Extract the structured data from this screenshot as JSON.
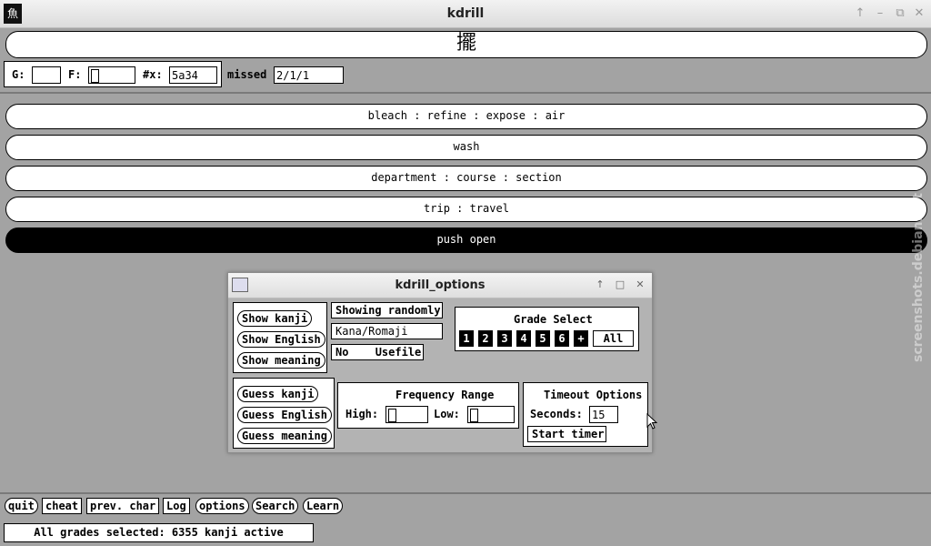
{
  "window": {
    "title": "kdrill",
    "app_icon_glyph": "魚"
  },
  "kanji": {
    "character": "擺"
  },
  "search": {
    "grade_label": "G:",
    "grade_value": "",
    "frequency_label": "F:",
    "frequency_value": "",
    "index_label": "#x:",
    "index_value": "5a34",
    "missed_label": "missed",
    "missed_value": "2/1/1"
  },
  "choices": [
    {
      "label": "bleach : refine : expose : air"
    },
    {
      "label": "wash"
    },
    {
      "label": "department : course : section"
    },
    {
      "label": "trip : travel"
    },
    {
      "label": "push open"
    }
  ],
  "options_dialog": {
    "title": "kdrill_options",
    "show_buttons": [
      "Show kanji",
      "Show English",
      "Show meaning"
    ],
    "showing_order": "Showing randomly",
    "reading_mode": "Kana/Romaji",
    "usefile_state": "No",
    "usefile_label": "Usefile",
    "grade_select_title": "Grade Select",
    "grades": [
      "1",
      "2",
      "3",
      "4",
      "5",
      "6",
      "+"
    ],
    "all_label": "All",
    "guess_buttons": [
      "Guess kanji",
      "Guess English",
      "Guess meaning"
    ],
    "frequency_range_title": "Frequency Range",
    "high_label": "High:",
    "high_value": "",
    "low_label": "Low:",
    "low_value": "",
    "timeout_title": "Timeout Options",
    "seconds_label": "Seconds:",
    "seconds_value": "15",
    "start_timer_label": "Start timer"
  },
  "bottom_buttons": {
    "quit": "quit",
    "cheat": "cheat",
    "prev_char": "prev. char",
    "log": "Log",
    "options": "options",
    "search": "Search",
    "learn": "Learn"
  },
  "status": "All grades selected: 6355 kanji active",
  "watermark": "screenshots.debian.net",
  "colors": {
    "background": "#a3a3a3",
    "selected_choice": "#000000",
    "panel": "#ffffff"
  }
}
